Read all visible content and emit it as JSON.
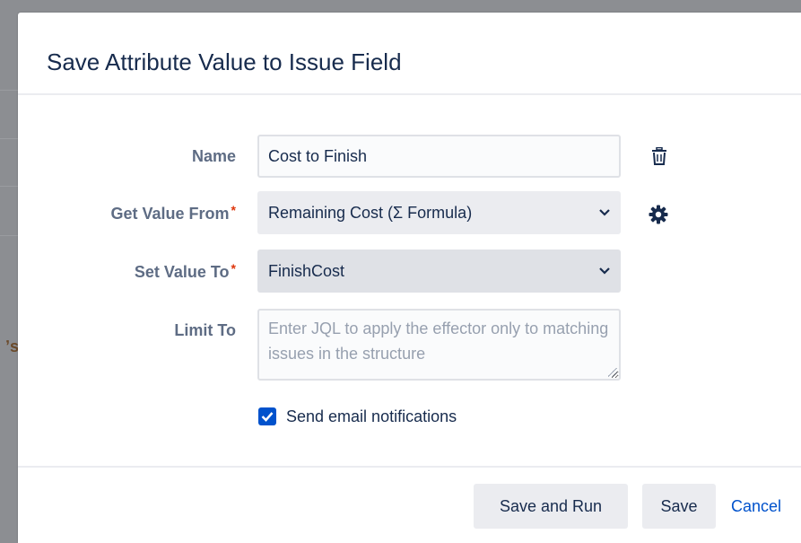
{
  "dialog": {
    "title": "Save Attribute Value to Issue Field"
  },
  "form": {
    "name": {
      "label": "Name",
      "value": "Cost to Finish"
    },
    "get_value_from": {
      "label": "Get Value From",
      "required_mark": "*",
      "selected": "Remaining Cost (Σ Formula)"
    },
    "set_value_to": {
      "label": "Set Value To",
      "required_mark": "*",
      "selected": "FinishCost"
    },
    "limit_to": {
      "label": "Limit To",
      "placeholder": "Enter JQL to apply the effector only to matching issues in the structure"
    },
    "send_email": {
      "label": "Send email notifications",
      "checked": true
    }
  },
  "footer": {
    "save_and_run_label": "Save and Run",
    "save_label": "Save",
    "cancel_label": "Cancel"
  },
  "icons": {
    "delete": "trash-icon",
    "settings": "gear-icon",
    "dropdown": "chevron-down-icon",
    "check": "checkmark-icon"
  },
  "colors": {
    "primary": "#0052cc",
    "required": "#de350b",
    "text": "#172b4d",
    "label": "#5e6c84"
  }
}
